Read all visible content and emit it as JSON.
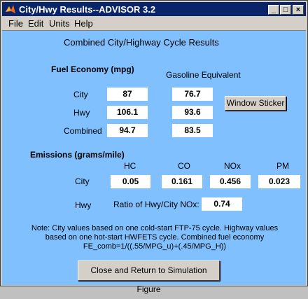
{
  "window": {
    "title": "City/Hwy Results--ADVISOR 3.2"
  },
  "menu": [
    "File",
    "Edit",
    "Units",
    "Help"
  ],
  "heading": "Combined City/Highway Cycle Results",
  "fuel_economy": {
    "title": "Fuel Economy (mpg)",
    "gas_equiv_label": "Gasoline Equivalent",
    "rows": [
      {
        "label": "City",
        "mpg": "87",
        "gas_equiv": "76.7"
      },
      {
        "label": "Hwy",
        "mpg": "106.1",
        "gas_equiv": "93.6"
      },
      {
        "label": "Combined",
        "mpg": "94.7",
        "gas_equiv": "83.5"
      }
    ],
    "window_sticker_label": "Window Sticker"
  },
  "emissions": {
    "title": "Emissions (grams/mile)",
    "headers": [
      "HC",
      "CO",
      "NOx",
      "PM"
    ],
    "city_label": "City",
    "city_values": [
      "0.05",
      "0.161",
      "0.456",
      "0.023"
    ],
    "hwy_label": "Hwy",
    "ratio_label": "Ratio of Hwy/City NOx:",
    "ratio_value": "0.74"
  },
  "note": {
    "line1": "Note:  City values based on one cold-start FTP-75 cycle.  Highway values",
    "line2": "based on one hot-start HWFETS cycle. Combined fuel economy",
    "line3": "FE_comb=1/((.55/MPG_u)+(.45/MPG_H))"
  },
  "close_button_label": "Close and Return to Simulation Figure"
}
